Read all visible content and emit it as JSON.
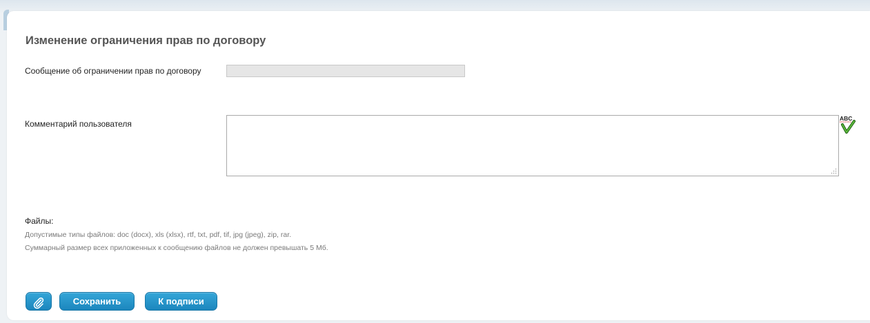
{
  "form": {
    "title": "Изменение ограничения прав по договору",
    "restriction_label": "Сообщение об ограничении прав по договору",
    "restriction_value": "",
    "comment_label": "Комментарий пользователя",
    "comment_value": "",
    "spellcheck_text": "ABC",
    "files_label": "Файлы:",
    "files_types_hint": "Допустимые типы файлов: doc (docx), xls (xlsx), rtf, txt, pdf, tif, jpg (jpeg), zip, rar.",
    "files_size_hint": "Суммарный размер всех приложенных к сообщению файлов не должен превышать 5 Мб."
  },
  "buttons": {
    "attach_icon": "paperclip-icon",
    "save_label": "Сохранить",
    "sign_label": "К подписи"
  },
  "colors": {
    "button_blue": "#2397cc",
    "title_gray": "#555555",
    "hint_gray": "#7a7a7a",
    "spellcheck_check": "#3a8a2a",
    "spellcheck_underline": "#cc2222"
  }
}
